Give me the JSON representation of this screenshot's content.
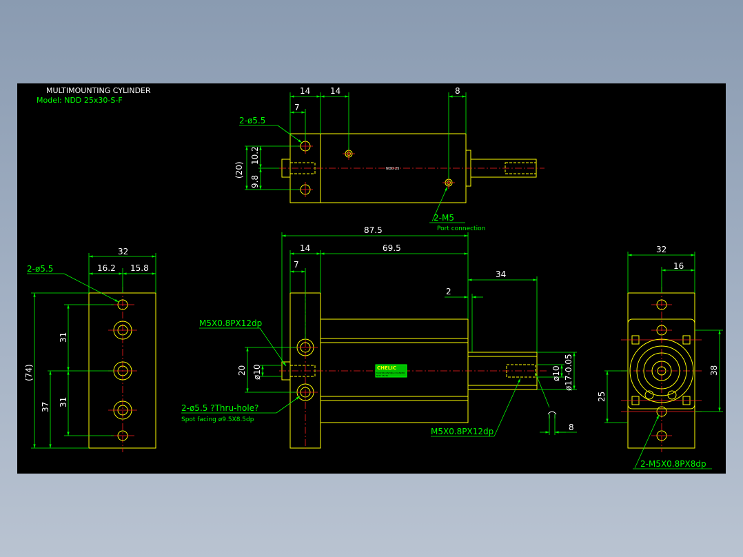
{
  "title": {
    "line1": "MULTIMOUNTING CYLINDER",
    "line2": "Model: NDD 25x30-S-F"
  },
  "colors": {
    "background": "#000000",
    "outline": "#ffff00",
    "dimension": "#00ff00",
    "centerline": "#ff2020",
    "dim_text": "#ffffff",
    "frame": "#9aa9bd"
  },
  "top_view": {
    "dim_14a": "14",
    "dim_14b": "14",
    "dim_8": "8",
    "dim_7": "7",
    "hole_note": "2-ø5.5",
    "dim_20": "(20)",
    "dim_10_2": "10.2",
    "dim_9_8": "9.8",
    "body_label": "NDD 25",
    "port_note": "2-M5",
    "port_desc": "Port connection"
  },
  "front_view": {
    "dim_87_5": "87.5",
    "dim_14": "14",
    "dim_69_5": "69.5",
    "dim_7": "7",
    "dim_34": "34",
    "dim_2": "2",
    "thread_note_left": "M5X0.8PX12dp",
    "dim_20": "20",
    "dim_phi10_left": "ø10",
    "dim_phi10_right": "ø10",
    "dim_phi17": "ø17-0.05",
    "hole_note": "2-ø5.5 ?Thru-hole?",
    "spot_note": "Spot facing ø9.5X8.5dp",
    "thread_note_right": "M5X0.8PX12dp",
    "dim_8": "8",
    "logo_text": "CHELIC",
    "label_line2": "MULTIMOUNTING CYLINDER",
    "label_line3": "NDD 25x30"
  },
  "left_view": {
    "dim_32": "32",
    "dim_16_2": "16.2",
    "dim_15_8": "15.8",
    "hole_note": "2-ø5.5",
    "dim_74": "(74)",
    "dim_31a": "31",
    "dim_31b": "31",
    "dim_37": "37"
  },
  "right_view": {
    "dim_32": "32",
    "dim_16": "16",
    "dim_38": "38",
    "dim_25": "25",
    "thread_note": "2-M5X0.8PX8dp"
  }
}
